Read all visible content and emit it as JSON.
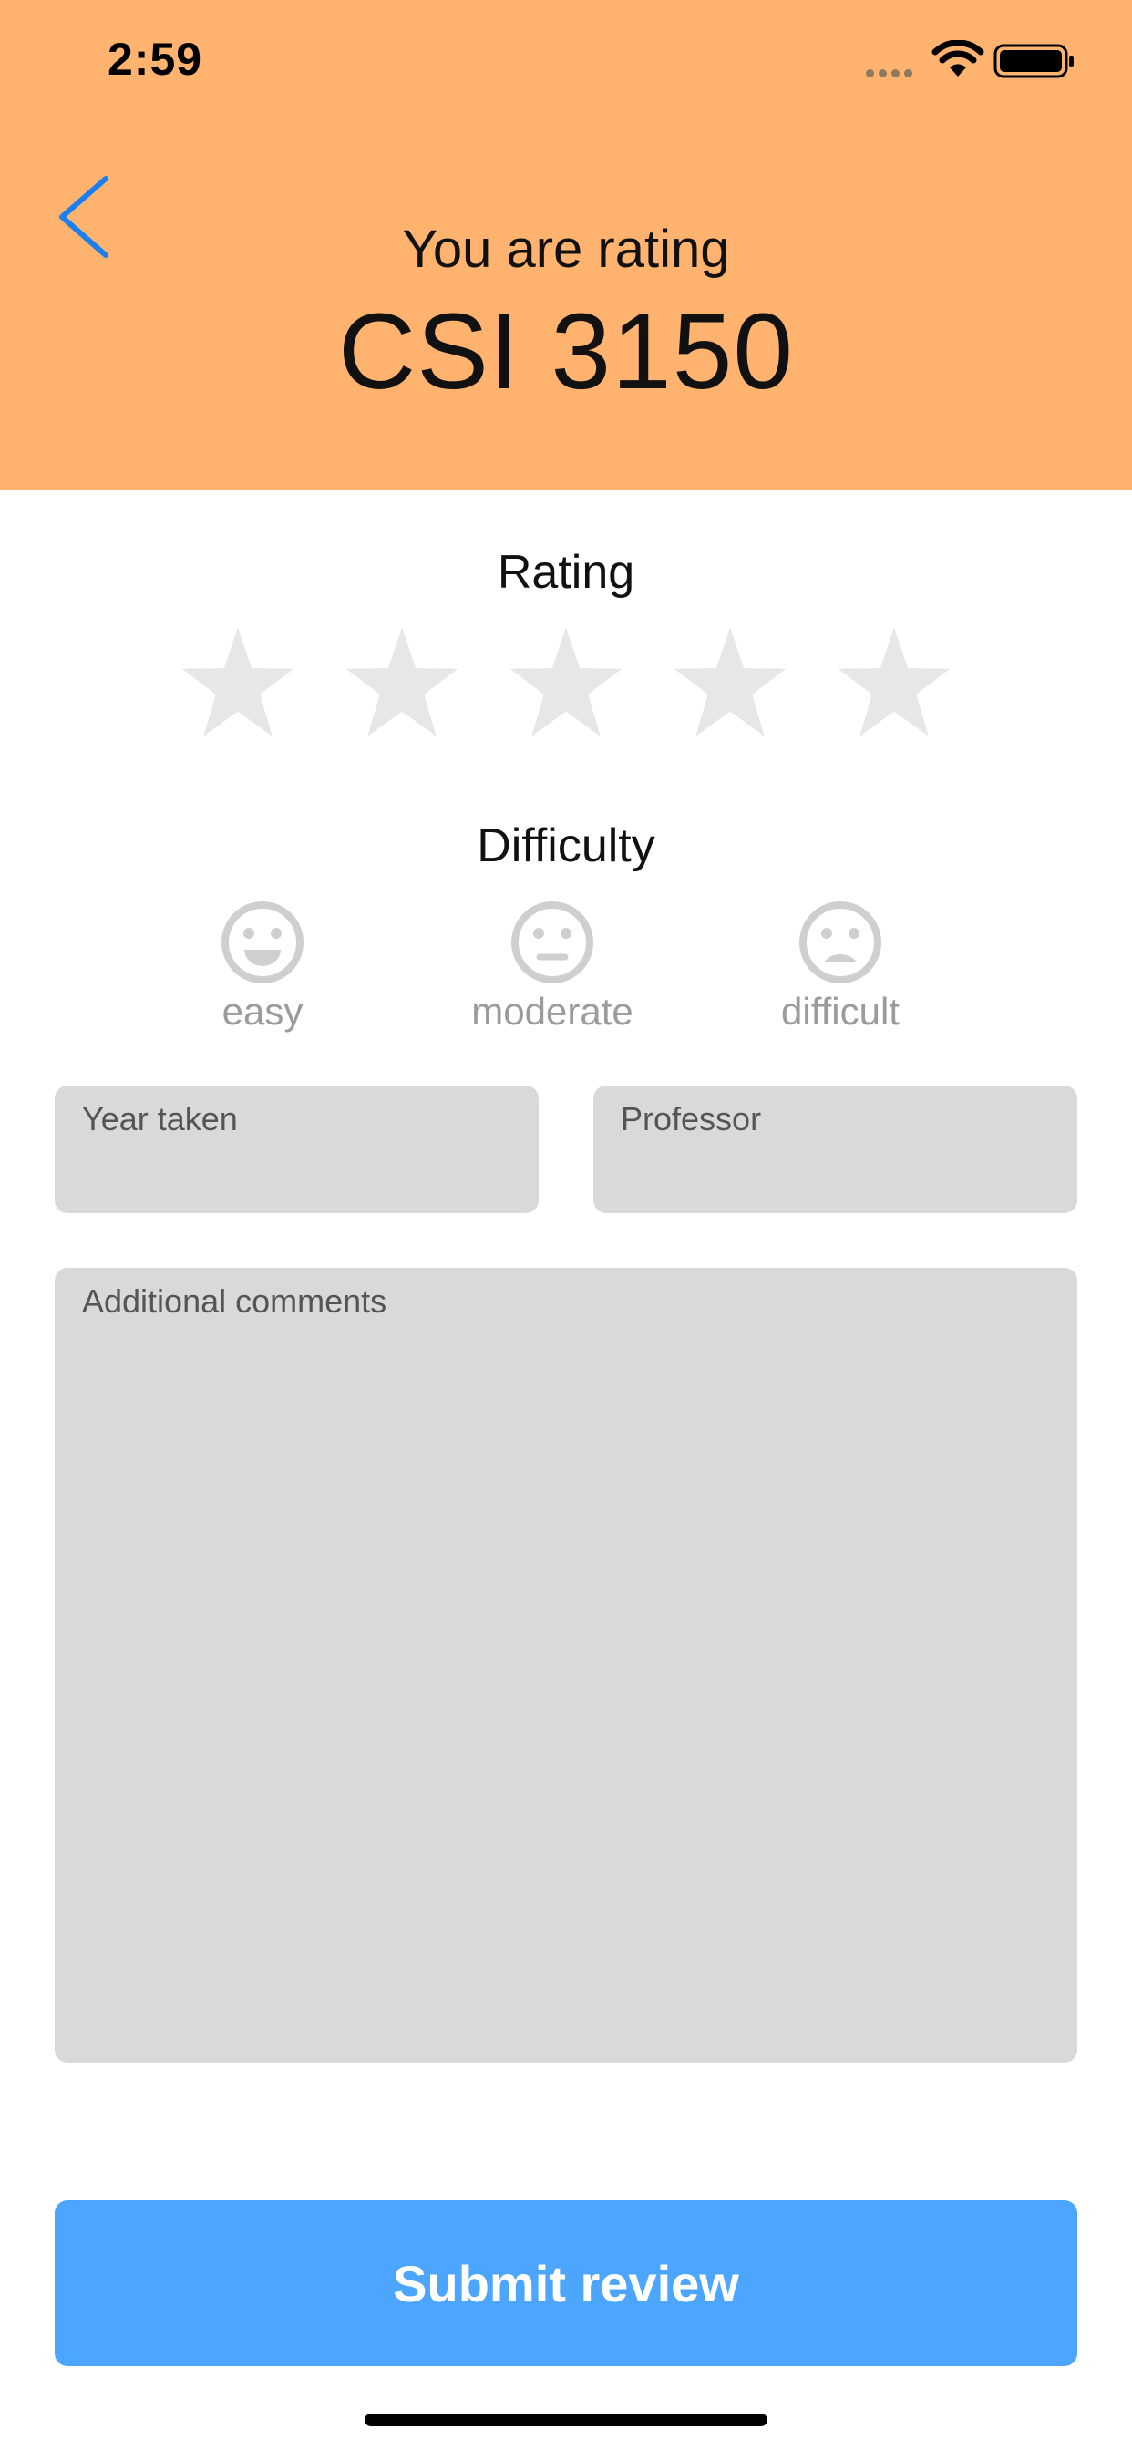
{
  "status_bar": {
    "time": "2:59"
  },
  "header": {
    "intro": "You are rating",
    "course_code": "CSI 3150",
    "background_color": "#FFB36F",
    "accent_color": "#1A7FF0"
  },
  "rating": {
    "label": "Rating",
    "max_stars": 5,
    "value": 0,
    "star_empty_color": "#E6E7E9"
  },
  "difficulty": {
    "label": "Difficulty",
    "options": [
      {
        "label": "easy",
        "icon": "smile-face-icon"
      },
      {
        "label": "moderate",
        "icon": "neutral-face-icon"
      },
      {
        "label": "difficult",
        "icon": "frown-face-icon"
      }
    ],
    "icon_color": "#CFCFCF"
  },
  "form": {
    "year_placeholder": "Year taken",
    "professor_placeholder": "Professor",
    "comments_placeholder": "Additional comments",
    "field_background": "#D9D9D9"
  },
  "submit": {
    "label": "Submit review",
    "color": "#4CA5FF"
  }
}
